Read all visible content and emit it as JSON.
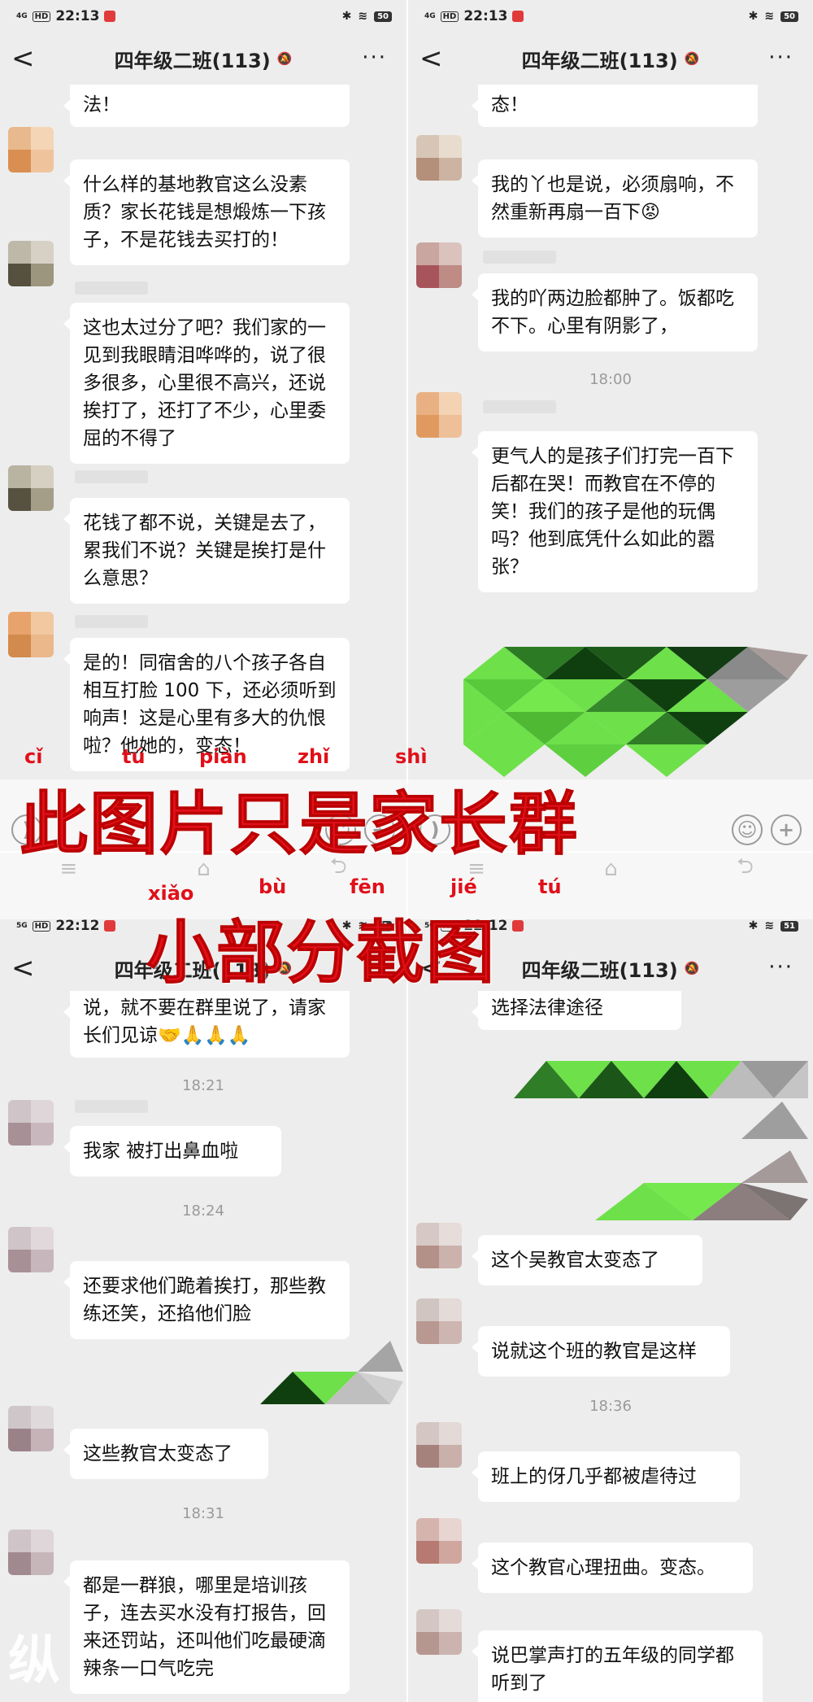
{
  "status_top": {
    "time": "22:13",
    "signal": "4G",
    "battery": "50"
  },
  "status_bottom_left": {
    "time": "22:12",
    "signal": "5G",
    "battery": "51"
  },
  "status_bottom_right": {
    "time": "22:12",
    "battery": "51"
  },
  "chat_title": "四年级二班(113)",
  "p1": {
    "cut_top": "法！",
    "m1": "什么样的基地教官这么没素质？家长花钱是想煅炼一下孩子，不是花钱去买打的！",
    "m2": "这也太过分了吧？我们家的一见到我眼睛泪哗哗的，说了很多很多，心里很不高兴，还说挨打了，还打了不少，心里委屈的不得了",
    "m3": "花钱了都不说，关键是去了，累我们不说？关键是挨打是什么意思？",
    "m4": "是的！同宿舍的八个孩子各自相互打脸 100 下，还必须听到响声！这是心里有多大的仇恨啦？他她的，变态！"
  },
  "p2": {
    "cut_top": "态！",
    "m1": "我的丫也是说，必须扇响，不然重新再扇一百下😡",
    "m2": "我的吖两边脸都肿了。饭都吃不下。心里有阴影了，",
    "time1": "18:00",
    "m3": "更气人的是孩子们打完一百下后都在哭！而教官在不停的笑！我们的孩子是他的玩偶吗？他到底凭什么如此的嚣张？"
  },
  "p3": {
    "cut_top": "说，就不要在群里说了，请家长们见谅🤝🙏🙏🙏",
    "time1": "18:21",
    "m1": "我家 被打出鼻血啦",
    "time2": "18:24",
    "m2": "还要求他们跪着挨打，那些教练还笑，还掐他们脸",
    "m3": "这些教官太变态了",
    "time3": "18:31",
    "m4": "都是一群狼，哪里是培训孩子，连去买水没有打报告，回来还罚站，还叫他们吃最硬滴辣条一口气吃完"
  },
  "p4": {
    "cut_top": "选择法律途径",
    "m1": "这个吴教官太变态了",
    "m2": "说就这个班的教官是这样",
    "time1": "18:36",
    "m3": "班上的伢几乎都被虐待过",
    "m4": "这个教官心理扭曲。变态。",
    "m5": "说巴掌声打的五年级的同学都听到了"
  },
  "caption": {
    "line1": "此图片只是家长群",
    "line2": "小部分截图",
    "pinyin1": [
      "cǐ",
      "tú",
      "piàn",
      "zhǐ",
      "shì"
    ],
    "pinyin2": [
      "xiǎo",
      "bù",
      "fēn",
      "jié",
      "tú"
    ]
  },
  "colors": {
    "caption": "#e0101a",
    "mosaic_green": "#6ee04a",
    "mosaic_dark": "#0f3f0f"
  }
}
